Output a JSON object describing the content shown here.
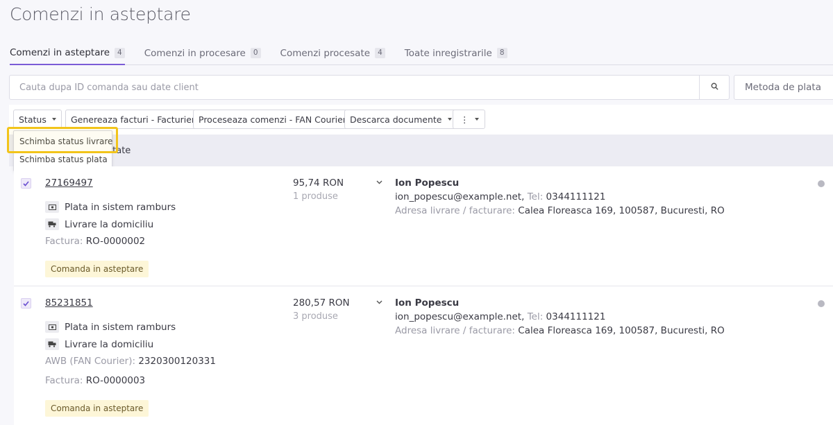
{
  "page": {
    "title": "Comenzi in asteptare"
  },
  "tabs": [
    {
      "label": "Comenzi in asteptare",
      "count": "4"
    },
    {
      "label": "Comenzi in procesare",
      "count": "0"
    },
    {
      "label": "Comenzi procesate",
      "count": "4"
    },
    {
      "label": "Toate inregistrarile",
      "count": "8"
    }
  ],
  "search": {
    "placeholder": "Cauta dupa ID comanda sau date client"
  },
  "filter": {
    "payment_method": "Metoda de plata"
  },
  "toolbar": {
    "status": "Status",
    "invoices": "Genereaza facturi - Facturier",
    "fan": "Proceseaza comenzi - FAN Courier",
    "download": "Descarca documente",
    "more": "⋮"
  },
  "dropdown": {
    "items": [
      "Schimba status livrare",
      "Schimba status plata"
    ]
  },
  "selection": {
    "text_suffix": "ctate"
  },
  "orders": [
    {
      "id": "27169497",
      "payment": "Plata in sistem ramburs",
      "delivery": "Livrare la domiciliu",
      "invoice_label": "Factura:",
      "invoice": "RO-0000002",
      "status": "Comanda in asteptare",
      "amount": "95,74 RON",
      "products": "1 produse",
      "customer": "Ion Popescu",
      "email": "ion_popescu@example.net,",
      "tel_label": "Tel:",
      "tel": "0344111121",
      "address_label": "Adresa livrare / facturare:",
      "address": "Calea Floreasca 169, 100587, Bucuresti, RO"
    },
    {
      "id": "85231851",
      "payment": "Plata in sistem ramburs",
      "delivery": "Livrare la domiciliu",
      "awb_label": "AWB (FAN Courier):",
      "awb": "2320300120331",
      "invoice_label": "Factura:",
      "invoice": "RO-0000003",
      "status": "Comanda in asteptare",
      "amount": "280,57 RON",
      "products": "3 produse",
      "customer": "Ion Popescu",
      "email": "ion_popescu@example.net,",
      "tel_label": "Tel:",
      "tel": "0344111121",
      "address_label": "Adresa livrare / facturare:",
      "address": "Calea Floreasca 169, 100587, Bucuresti, RO"
    }
  ],
  "colors": {
    "accent": "#7b5cd6",
    "highlight": "#f2c41a",
    "status_bg": "#fdf6d8"
  }
}
